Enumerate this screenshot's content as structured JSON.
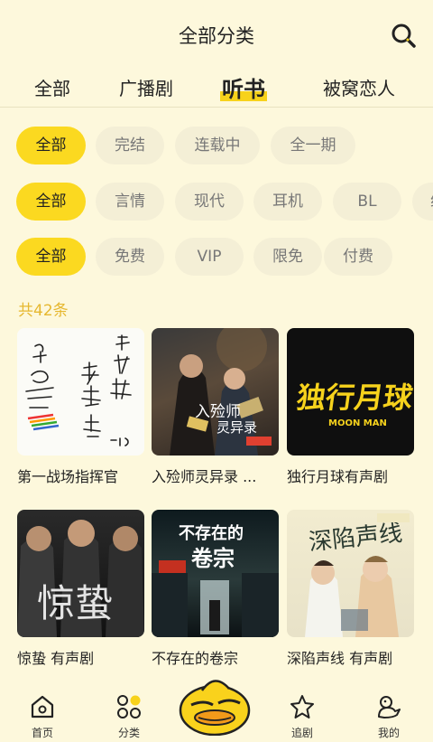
{
  "header": {
    "title": "全部分类",
    "search_icon": "search-icon"
  },
  "tabs": [
    {
      "label": "全部",
      "active": false
    },
    {
      "label": "广播剧",
      "active": false
    },
    {
      "label": "听书",
      "active": true
    },
    {
      "label": "被窝恋人",
      "active": false
    }
  ],
  "filters": {
    "status": [
      "全部",
      "完结",
      "连载中",
      "全一期"
    ],
    "genre": [
      "全部",
      "言情",
      "现代",
      "耳机",
      "BL",
      "纯爱"
    ],
    "price": [
      "全部",
      "免费",
      "VIP",
      "限免",
      "付费"
    ]
  },
  "count_label": "共42条",
  "items": [
    {
      "title": "第一战场指挥官",
      "cover_text": "第一战场指挥官"
    },
    {
      "title": "入殓师灵异录 ...",
      "cover_text": "入殓师灵异录"
    },
    {
      "title": "独行月球有声剧",
      "cover_text": "独行月球",
      "cover_sub": "MOON MAN"
    },
    {
      "title": "惊蛰 有声剧",
      "cover_text": "惊蛰"
    },
    {
      "title": "不存在的卷宗",
      "cover_text": "不存在的卷宗"
    },
    {
      "title": "深陷声线 有声剧",
      "cover_text": "深陷声线"
    }
  ],
  "bottom_nav": [
    {
      "label": "首页",
      "icon": "home-icon"
    },
    {
      "label": "分类",
      "icon": "category-icon"
    },
    {
      "label": "",
      "icon": "duck-center-icon"
    },
    {
      "label": "追剧",
      "icon": "star-icon"
    },
    {
      "label": "我的",
      "icon": "duck-profile-icon"
    }
  ],
  "colors": {
    "accent": "#fbd920",
    "background": "#fdf8dc",
    "count": "#e6b830"
  }
}
